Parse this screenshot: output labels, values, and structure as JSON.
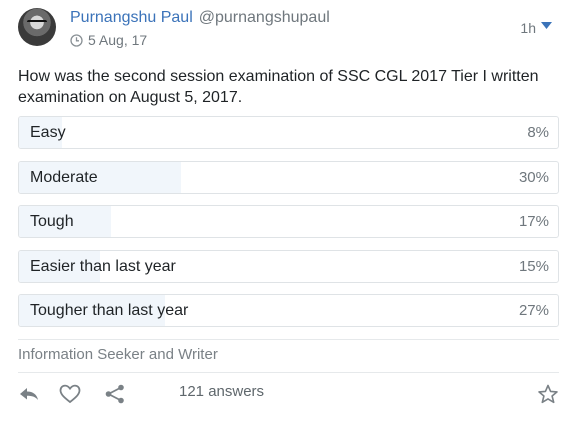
{
  "post": {
    "author_name": "Purnangshu Paul",
    "handle": "@purnangshupaul",
    "date": "5 Aug, 17",
    "time_ago": "1h",
    "question": "How was the second session examination of SSC CGL 2017 Tier I written examination on August 5, 2017.",
    "bio": "Information Seeker and Writer",
    "answers_label": "121 answers"
  },
  "options": [
    {
      "label": "Easy",
      "percent_label": "8%",
      "fraction": 0.08
    },
    {
      "label": "Moderate",
      "percent_label": "30%",
      "fraction": 0.3
    },
    {
      "label": "Tough",
      "percent_label": "17%",
      "fraction": 0.17
    },
    {
      "label": "Easier than last year",
      "percent_label": "15%",
      "fraction": 0.15
    },
    {
      "label": "Tougher than last year",
      "percent_label": "27%",
      "fraction": 0.27
    }
  ],
  "colors": {
    "accent": "#3b73b9",
    "bar_fill": "#f1f6fb",
    "muted_text": "#6f777d"
  },
  "icons": [
    "clock-icon",
    "caret-down-icon",
    "reply-icon",
    "heart-icon",
    "share-icon",
    "star-icon"
  ]
}
